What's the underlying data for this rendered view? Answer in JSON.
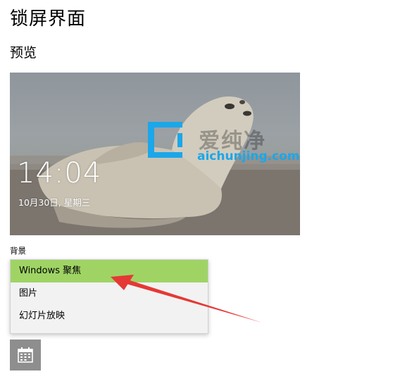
{
  "page": {
    "title": "锁屏界面",
    "preview_heading": "预览"
  },
  "lock_preview": {
    "time": "14:04",
    "date": "10月30日, 星期三",
    "watermark_cn": "爱纯净",
    "watermark_url": "aichunjing.com"
  },
  "background": {
    "label": "背景",
    "options": [
      "Windows 聚焦",
      "图片",
      "幻灯片放映"
    ],
    "selected": "Windows 聚焦"
  },
  "icons": {
    "calendar": "calendar-icon",
    "watermark_logo": "watermark-logo-icon",
    "arrow": "red-arrow-annotation"
  },
  "colors": {
    "selected_option": "#9fd465",
    "arrow": "#e53935",
    "watermark_blue": "#1ba7ea"
  }
}
